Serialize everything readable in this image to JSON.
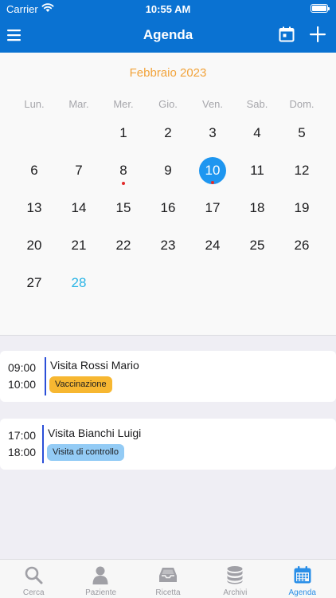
{
  "status": {
    "carrier": "Carrier",
    "time": "10:55 AM"
  },
  "header": {
    "title": "Agenda"
  },
  "calendar": {
    "month": "Febbraio 2023",
    "weekdays": [
      "Lun.",
      "Mar.",
      "Mer.",
      "Gio.",
      "Ven.",
      "Sab.",
      "Dom."
    ],
    "weeks": [
      [
        "",
        "",
        "1",
        "2",
        "3",
        "4",
        "5"
      ],
      [
        "6",
        "7",
        "8",
        "9",
        "10",
        "11",
        "12"
      ],
      [
        "13",
        "14",
        "15",
        "16",
        "17",
        "18",
        "19"
      ],
      [
        "20",
        "21",
        "22",
        "23",
        "24",
        "25",
        "26"
      ],
      [
        "27",
        "28",
        "",
        "",
        "",
        "",
        ""
      ]
    ],
    "selected_day": "10",
    "today": "28",
    "event_days": [
      "8",
      "10"
    ]
  },
  "events": [
    {
      "start": "09:00",
      "end": "10:00",
      "title": "Visita Rossi Mario",
      "tag": "Vaccinazione",
      "tag_color": "#f7b731"
    },
    {
      "start": "17:00",
      "end": "18:00",
      "title": "Visita Bianchi Luigi",
      "tag": "Visita di controllo",
      "tag_color": "#93cbf5"
    }
  ],
  "tabs": [
    {
      "label": "Cerca",
      "icon": "search-icon"
    },
    {
      "label": "Paziente",
      "icon": "person-icon"
    },
    {
      "label": "Ricetta",
      "icon": "inbox-icon"
    },
    {
      "label": "Archivi",
      "icon": "database-icon"
    },
    {
      "label": "Agenda",
      "icon": "calendar-icon",
      "active": true
    }
  ],
  "colors": {
    "accent": "#0a72d2",
    "month_title": "#f2a33a",
    "selected": "#1e96f0",
    "today": "#2bb5e6",
    "event_dot": "#e12a2a",
    "active_tab": "#2a8fe8"
  }
}
